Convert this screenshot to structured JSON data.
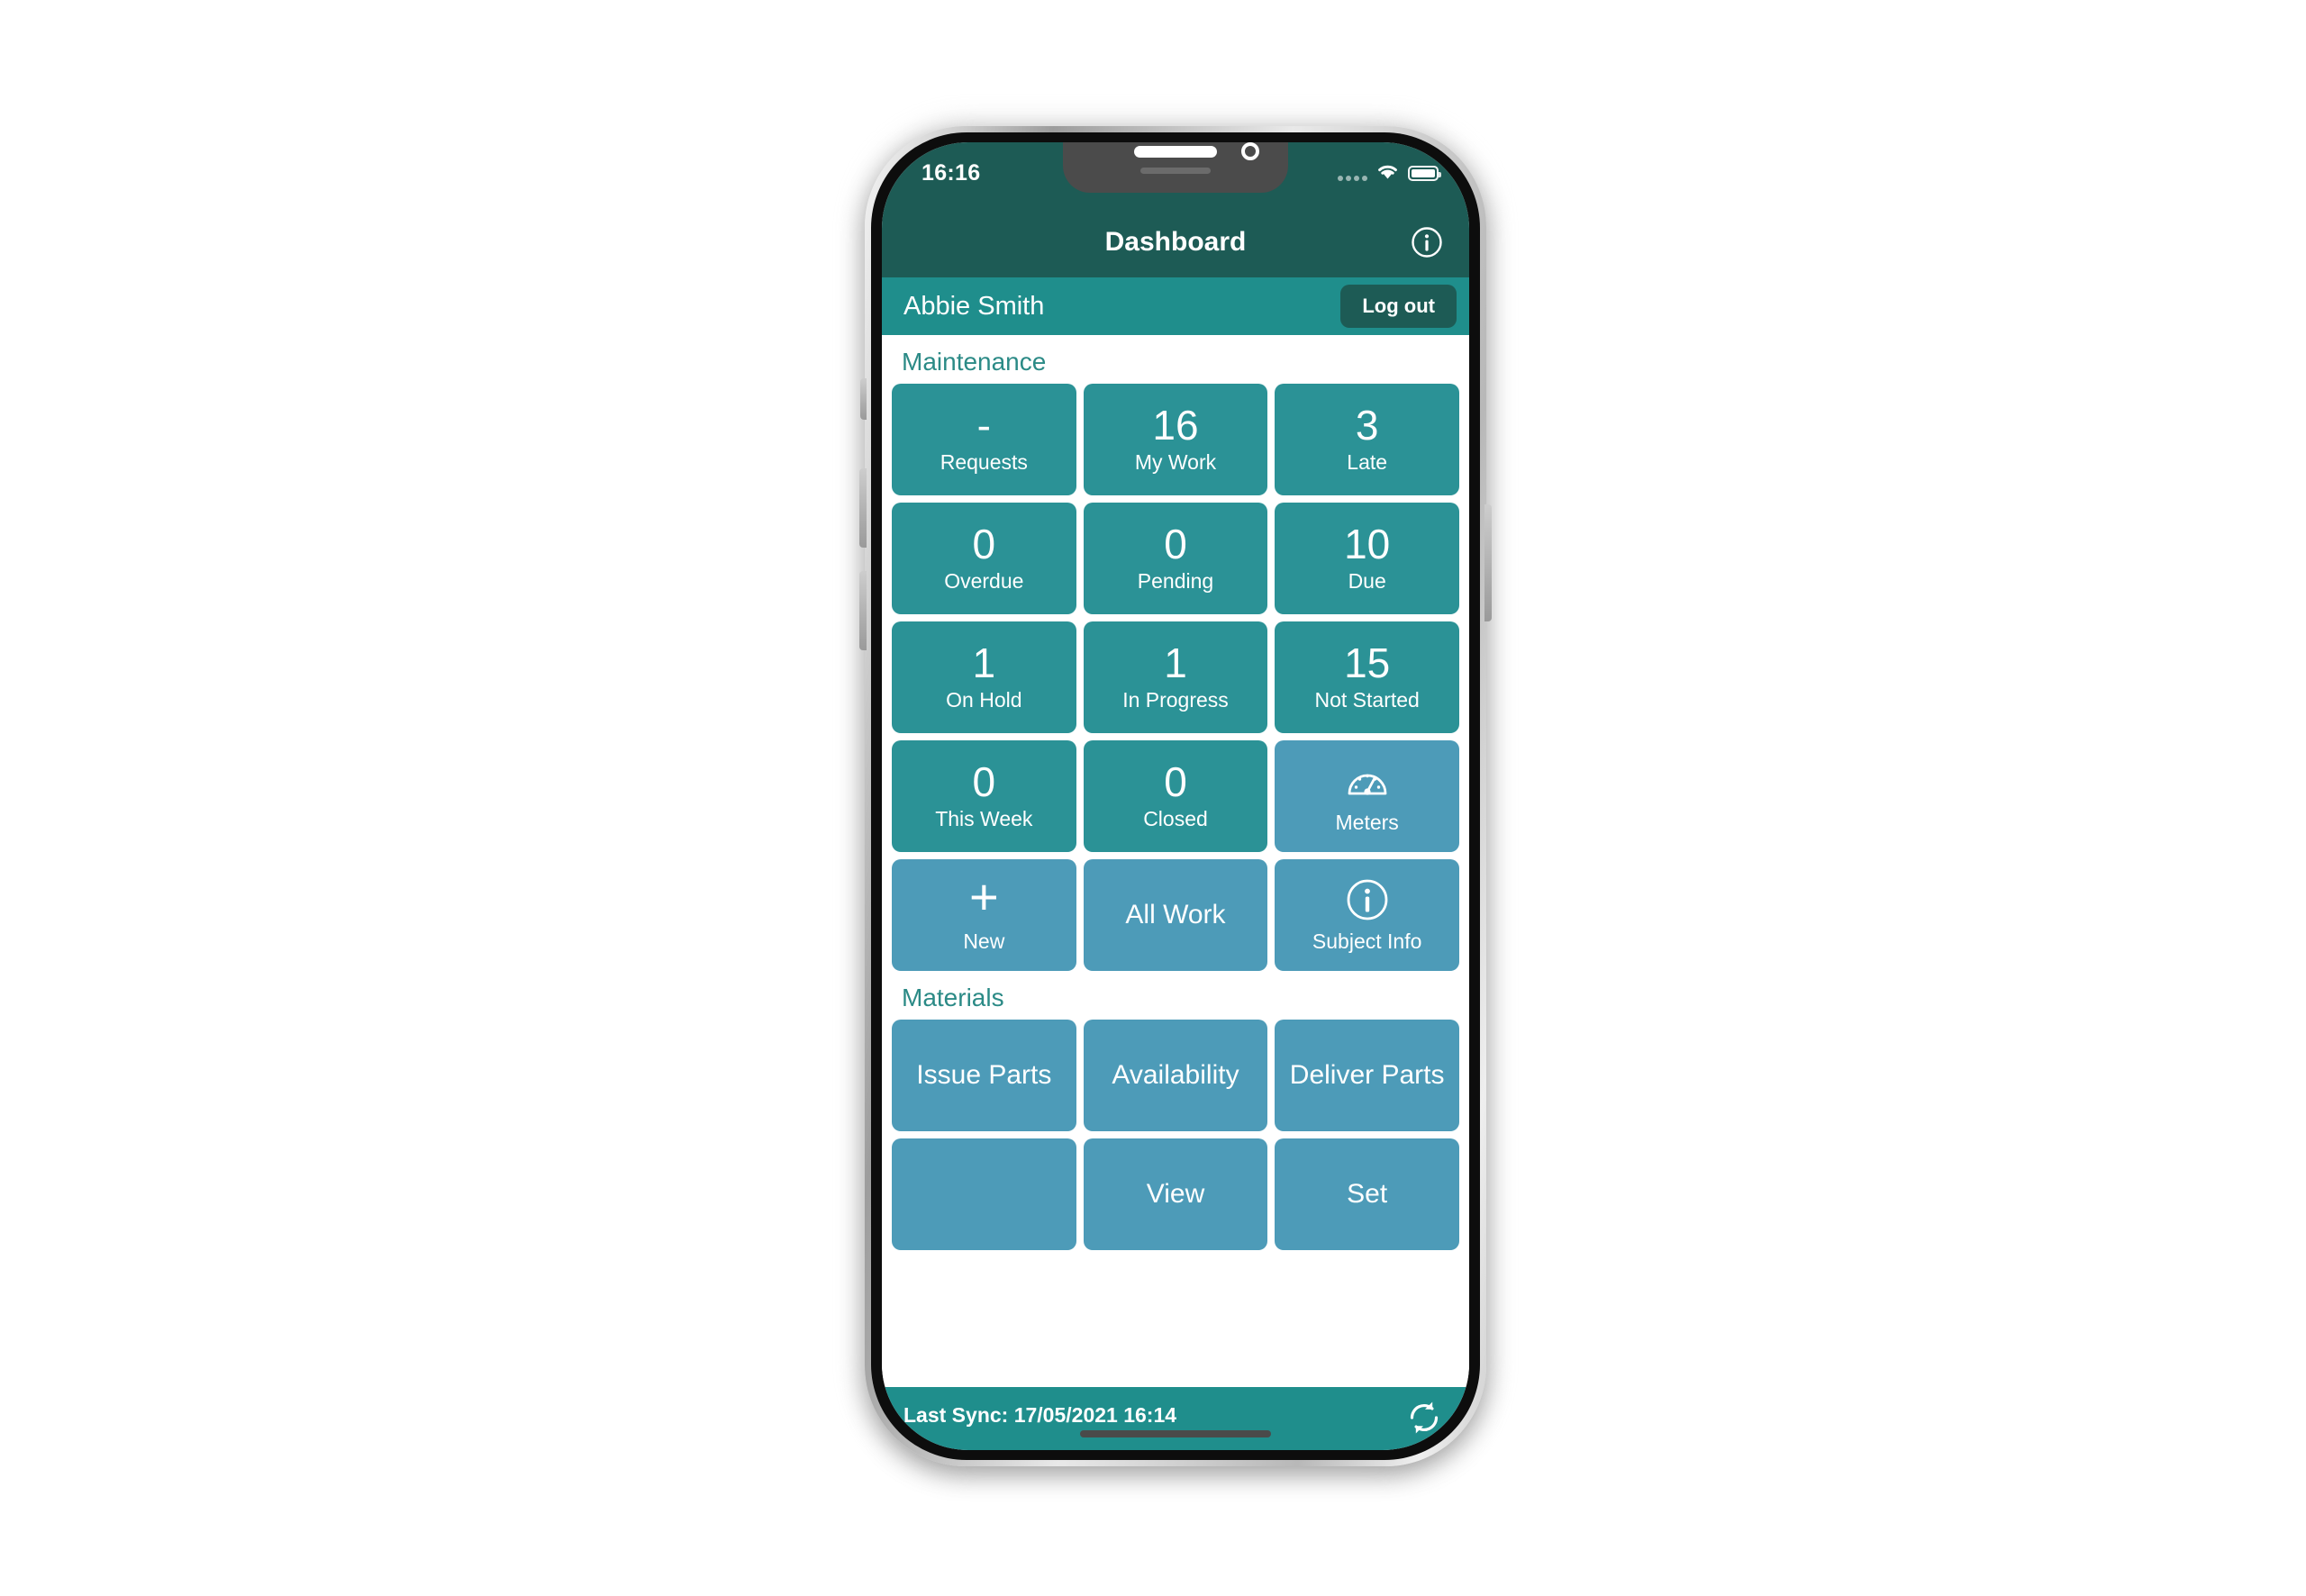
{
  "status_bar": {
    "time": "16:16",
    "wifi_icon": "wifi-icon",
    "battery_icon": "battery-full-icon",
    "signal_icon": "signal-dots-icon"
  },
  "nav": {
    "title": "Dashboard",
    "info_icon": "info-circle-icon"
  },
  "user_bar": {
    "name": "Abbie Smith",
    "logout_label": "Log out"
  },
  "sections": [
    {
      "title": "Maintenance",
      "tiles": [
        {
          "value": "-",
          "label": "Requests",
          "style": "teal",
          "kind": "stat"
        },
        {
          "value": "16",
          "label": "My Work",
          "style": "teal",
          "kind": "stat"
        },
        {
          "value": "3",
          "label": "Late",
          "style": "teal",
          "kind": "stat"
        },
        {
          "value": "0",
          "label": "Overdue",
          "style": "teal",
          "kind": "stat"
        },
        {
          "value": "0",
          "label": "Pending",
          "style": "teal",
          "kind": "stat"
        },
        {
          "value": "10",
          "label": "Due",
          "style": "teal",
          "kind": "stat"
        },
        {
          "value": "1",
          "label": "On Hold",
          "style": "teal",
          "kind": "stat"
        },
        {
          "value": "1",
          "label": "In Progress",
          "style": "teal",
          "kind": "stat"
        },
        {
          "value": "15",
          "label": "Not Started",
          "style": "teal",
          "kind": "stat"
        },
        {
          "value": "0",
          "label": "This Week",
          "style": "teal",
          "kind": "stat"
        },
        {
          "value": "0",
          "label": "Closed",
          "style": "teal",
          "kind": "stat"
        },
        {
          "value": "",
          "label": "Meters",
          "style": "blue",
          "kind": "icon",
          "icon": "gauge-icon"
        },
        {
          "value": "+",
          "label": "New",
          "style": "blue",
          "kind": "plus"
        },
        {
          "value": "All Work",
          "label": "",
          "style": "blue",
          "kind": "text"
        },
        {
          "value": "",
          "label": "Subject Info",
          "style": "blue",
          "kind": "icon",
          "icon": "info-circle-icon"
        }
      ]
    },
    {
      "title": "Materials",
      "tiles": [
        {
          "value": "Issue Parts",
          "label": "",
          "style": "blue",
          "kind": "text"
        },
        {
          "value": "Availability",
          "label": "",
          "style": "blue",
          "kind": "text"
        },
        {
          "value": "Deliver Parts",
          "label": "",
          "style": "blue",
          "kind": "text"
        },
        {
          "value": "",
          "label": "",
          "style": "blue",
          "kind": "text"
        },
        {
          "value": "View",
          "label": "",
          "style": "blue",
          "kind": "text"
        },
        {
          "value": "Set",
          "label": "",
          "style": "blue",
          "kind": "text"
        }
      ]
    }
  ],
  "sync_bar": {
    "text": "Last Sync: 17/05/2021 16:14",
    "refresh_icon": "refresh-icon"
  },
  "colors": {
    "nav_bar": "#1d5b55",
    "user_bar": "#1f8e8c",
    "tile_teal": "#2b9296",
    "tile_blue": "#4d9bb8",
    "section_title": "#2b8a86",
    "page_background": "#ffffff"
  }
}
